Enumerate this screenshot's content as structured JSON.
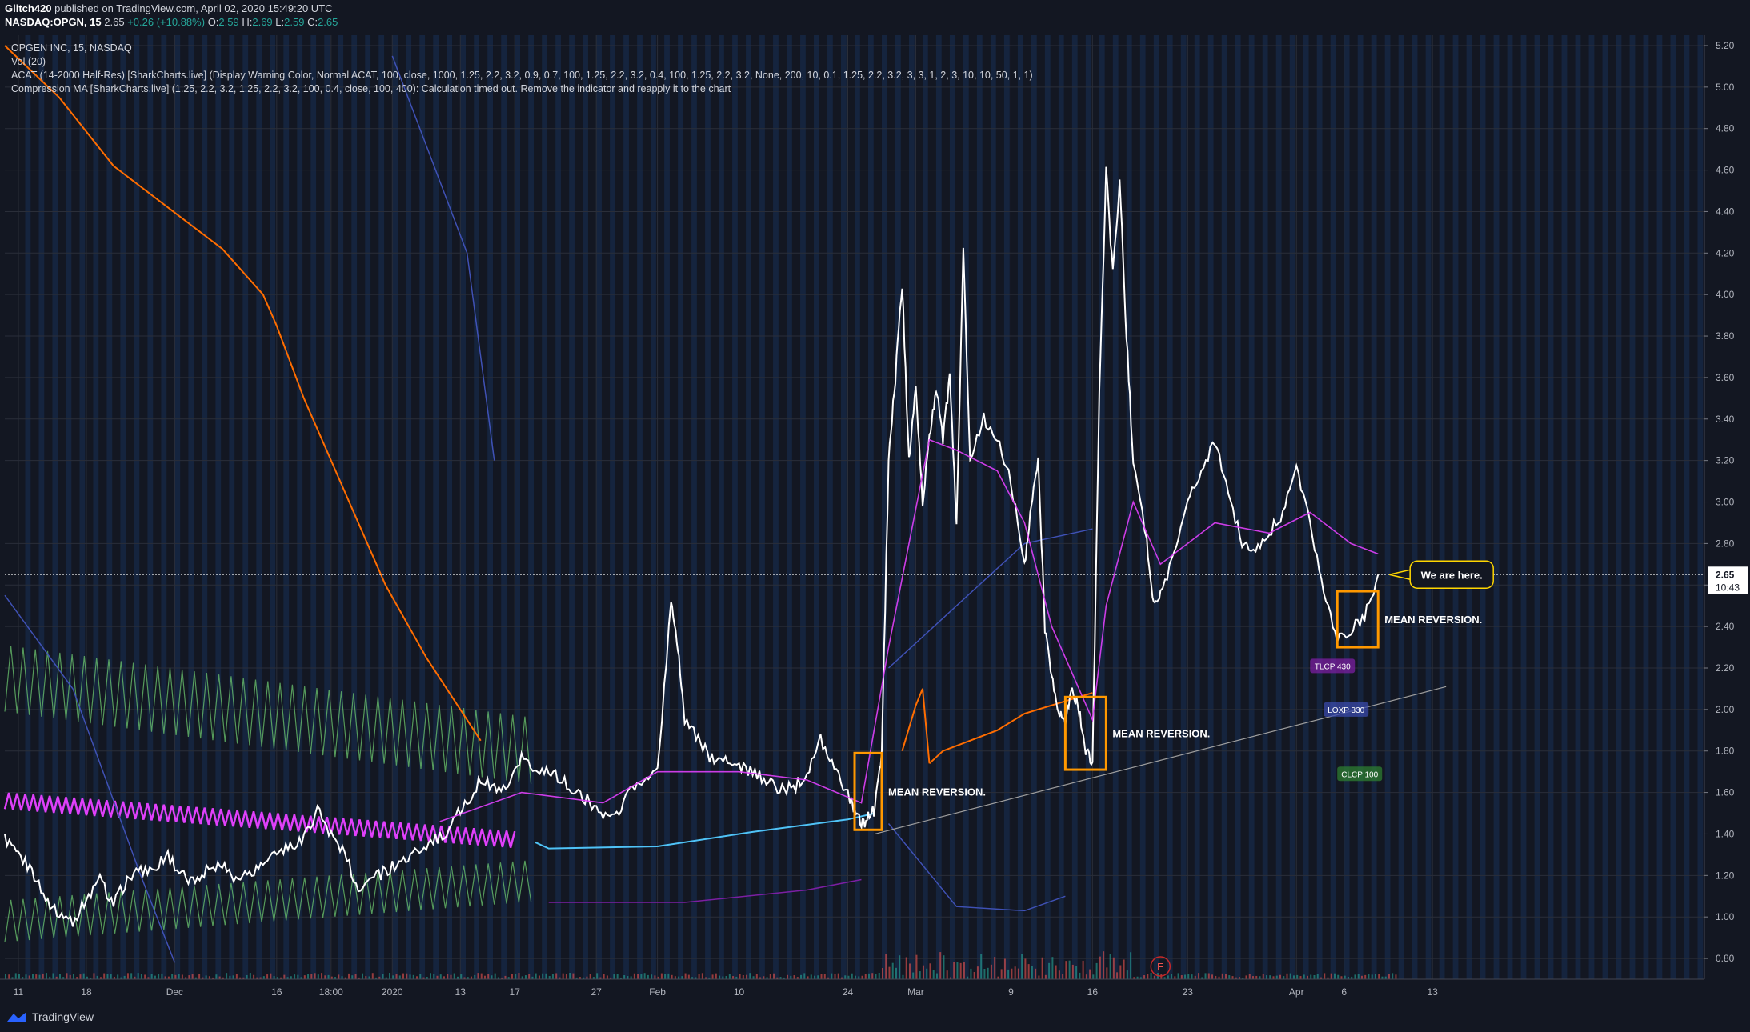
{
  "header": {
    "publisher": "Glitch420",
    "published_text": "published on TradingView.com, April 02, 2020 15:49:20 UTC",
    "symbol": "NASDAQ:OPGN, 15",
    "last": "2.65",
    "change": "+0.26 (+10.88%)",
    "o_label": "O:",
    "o": "2.59",
    "h_label": "H:",
    "h": "2.69",
    "l_label": "L:",
    "l": "2.59",
    "c_label": "C:",
    "c": "2.65"
  },
  "legend": {
    "title": "OPGEN INC, 15, NASDAQ",
    "vol": "Vol (20)",
    "acat": "ACAT (14-2000 Half-Res) [SharkCharts.live] (Display Warning Color, Normal ACAT, 100, close, 1000, 1.25, 2.2, 3.2, 0.9, 0.7, 100, 1.25, 2.2, 3.2, 0.4, 100, 1.25, 2.2, 3.2, None, 200, 10, 0.1, 1.25, 2.2, 3.2, 3, 3, 1, 2, 3, 10, 10, 50, 1, 1)",
    "compression": "Compression MA [SharkCharts.live] (1.25, 2.2, 3.2, 1.25, 2.2, 3.2, 100, 0.4, close, 100, 400): Calculation timed out. Remove the indicator and reapply it to the chart"
  },
  "colors": {
    "background": "#131722",
    "price": "#ffffff",
    "magenta": "#e040fb",
    "orange_ma": "#ff6d00",
    "cyan_ma": "#4fc3f7",
    "green_band": "#66bb6a",
    "blue_band": "#3f51b5",
    "annotation_box": "#ff9800",
    "last_price_tag": "#ffffff"
  },
  "chart_data": {
    "type": "line",
    "symbol": "NASDAQ:OPGN",
    "interval": "15",
    "y_axis_ticks": [
      "5.20",
      "5.00",
      "4.80",
      "4.60",
      "4.40",
      "4.20",
      "4.00",
      "3.80",
      "3.60",
      "3.40",
      "3.20",
      "3.00",
      "2.80",
      "2.60",
      "2.40",
      "2.20",
      "2.00",
      "1.80",
      "1.60",
      "1.40",
      "1.20",
      "1.00",
      "0.80"
    ],
    "ylim": [
      0.7,
      5.25
    ],
    "x_axis_ticks": [
      "11",
      "18",
      "Dec",
      "16",
      "18:00",
      "2020",
      "13",
      "17",
      "27",
      "Feb",
      "10",
      "24",
      "Mar",
      "9",
      "16",
      "23",
      "Apr",
      "6",
      "13"
    ],
    "price_series": [
      {
        "t": 0,
        "v": 1.38
      },
      {
        "t": 2,
        "v": 1.3
      },
      {
        "t": 4,
        "v": 1.22
      },
      {
        "t": 6,
        "v": 1.09
      },
      {
        "t": 8,
        "v": 1.02
      },
      {
        "t": 10,
        "v": 0.98
      },
      {
        "t": 12,
        "v": 1.08
      },
      {
        "t": 14,
        "v": 1.18
      },
      {
        "t": 16,
        "v": 1.06
      },
      {
        "t": 18,
        "v": 1.18
      },
      {
        "t": 20,
        "v": 1.22
      },
      {
        "t": 22,
        "v": 1.24
      },
      {
        "t": 24,
        "v": 1.3
      },
      {
        "t": 26,
        "v": 1.2
      },
      {
        "t": 28,
        "v": 1.16
      },
      {
        "t": 30,
        "v": 1.24
      },
      {
        "t": 32,
        "v": 1.26
      },
      {
        "t": 34,
        "v": 1.18
      },
      {
        "t": 36,
        "v": 1.22
      },
      {
        "t": 38,
        "v": 1.25
      },
      {
        "t": 40,
        "v": 1.3
      },
      {
        "t": 42,
        "v": 1.34
      },
      {
        "t": 44,
        "v": 1.38
      },
      {
        "t": 46,
        "v": 1.52
      },
      {
        "t": 48,
        "v": 1.4
      },
      {
        "t": 50,
        "v": 1.3
      },
      {
        "t": 52,
        "v": 1.14
      },
      {
        "t": 54,
        "v": 1.18
      },
      {
        "t": 56,
        "v": 1.22
      },
      {
        "t": 58,
        "v": 1.26
      },
      {
        "t": 60,
        "v": 1.3
      },
      {
        "t": 62,
        "v": 1.35
      },
      {
        "t": 64,
        "v": 1.38
      },
      {
        "t": 66,
        "v": 1.46
      },
      {
        "t": 68,
        "v": 1.56
      },
      {
        "t": 70,
        "v": 1.66
      },
      {
        "t": 72,
        "v": 1.62
      },
      {
        "t": 74,
        "v": 1.6
      },
      {
        "t": 76,
        "v": 1.78
      },
      {
        "t": 78,
        "v": 1.72
      },
      {
        "t": 80,
        "v": 1.7
      },
      {
        "t": 82,
        "v": 1.66
      },
      {
        "t": 84,
        "v": 1.6
      },
      {
        "t": 86,
        "v": 1.56
      },
      {
        "t": 88,
        "v": 1.48
      },
      {
        "t": 90,
        "v": 1.5
      },
      {
        "t": 92,
        "v": 1.62
      },
      {
        "t": 94,
        "v": 1.64
      },
      {
        "t": 96,
        "v": 1.7
      },
      {
        "t": 98,
        "v": 2.52
      },
      {
        "t": 99,
        "v": 2.3
      },
      {
        "t": 100,
        "v": 1.95
      },
      {
        "t": 102,
        "v": 1.85
      },
      {
        "t": 104,
        "v": 1.76
      },
      {
        "t": 106,
        "v": 1.75
      },
      {
        "t": 108,
        "v": 1.72
      },
      {
        "t": 110,
        "v": 1.7
      },
      {
        "t": 112,
        "v": 1.65
      },
      {
        "t": 114,
        "v": 1.62
      },
      {
        "t": 116,
        "v": 1.62
      },
      {
        "t": 118,
        "v": 1.7
      },
      {
        "t": 120,
        "v": 1.86
      },
      {
        "t": 122,
        "v": 1.72
      },
      {
        "t": 124,
        "v": 1.6
      },
      {
        "t": 125,
        "v": 1.52
      },
      {
        "t": 126,
        "v": 1.44
      },
      {
        "t": 127,
        "v": 1.48
      },
      {
        "t": 128,
        "v": 1.52
      },
      {
        "t": 129,
        "v": 1.8
      },
      {
        "t": 130,
        "v": 3.2
      },
      {
        "t": 131,
        "v": 3.6
      },
      {
        "t": 132,
        "v": 4.05
      },
      {
        "t": 133,
        "v": 3.2
      },
      {
        "t": 134,
        "v": 3.55
      },
      {
        "t": 135,
        "v": 3.0
      },
      {
        "t": 136,
        "v": 3.3
      },
      {
        "t": 137,
        "v": 3.55
      },
      {
        "t": 138,
        "v": 3.3
      },
      {
        "t": 139,
        "v": 3.6
      },
      {
        "t": 140,
        "v": 2.9
      },
      {
        "t": 141,
        "v": 4.2
      },
      {
        "t": 142,
        "v": 3.2
      },
      {
        "t": 144,
        "v": 3.4
      },
      {
        "t": 146,
        "v": 3.3
      },
      {
        "t": 148,
        "v": 3.1
      },
      {
        "t": 150,
        "v": 2.7
      },
      {
        "t": 151,
        "v": 3.0
      },
      {
        "t": 152,
        "v": 3.2
      },
      {
        "t": 153,
        "v": 2.4
      },
      {
        "t": 154,
        "v": 2.15
      },
      {
        "t": 155,
        "v": 2.0
      },
      {
        "t": 156,
        "v": 1.95
      },
      {
        "t": 157,
        "v": 2.1
      },
      {
        "t": 158,
        "v": 2.0
      },
      {
        "t": 159,
        "v": 1.8
      },
      {
        "t": 160,
        "v": 1.75
      },
      {
        "t": 161,
        "v": 3.5
      },
      {
        "t": 162,
        "v": 4.6
      },
      {
        "t": 163,
        "v": 4.1
      },
      {
        "t": 164,
        "v": 4.55
      },
      {
        "t": 165,
        "v": 3.8
      },
      {
        "t": 166,
        "v": 3.2
      },
      {
        "t": 168,
        "v": 2.8
      },
      {
        "t": 169,
        "v": 2.5
      },
      {
        "t": 170,
        "v": 2.55
      },
      {
        "t": 172,
        "v": 2.75
      },
      {
        "t": 174,
        "v": 3.0
      },
      {
        "t": 176,
        "v": 3.15
      },
      {
        "t": 178,
        "v": 3.3
      },
      {
        "t": 180,
        "v": 3.05
      },
      {
        "t": 182,
        "v": 2.8
      },
      {
        "t": 184,
        "v": 2.75
      },
      {
        "t": 186,
        "v": 2.85
      },
      {
        "t": 188,
        "v": 2.95
      },
      {
        "t": 190,
        "v": 3.15
      },
      {
        "t": 192,
        "v": 2.9
      },
      {
        "t": 194,
        "v": 2.55
      },
      {
        "t": 196,
        "v": 2.35
      },
      {
        "t": 198,
        "v": 2.38
      },
      {
        "t": 200,
        "v": 2.45
      },
      {
        "t": 202,
        "v": 2.65
      }
    ],
    "last_price": 2.65,
    "last_price_label": "2.65",
    "countdown_label": "10:43",
    "annotations": [
      {
        "text": "MEAN REVERSION.",
        "box_t": [
          125,
          129
        ],
        "box_v": [
          1.42,
          1.79
        ]
      },
      {
        "text": "MEAN REVERSION.",
        "box_t": [
          156,
          162
        ],
        "box_v": [
          1.71,
          2.06
        ]
      },
      {
        "text": "MEAN REVERSION.",
        "box_t": [
          196,
          202
        ],
        "box_v": [
          2.3,
          2.57
        ]
      }
    ],
    "callout": "We are here.",
    "tags": [
      {
        "text": "TLCP 430",
        "t": 192,
        "v": 2.21,
        "color": "#7b1fa2"
      },
      {
        "text": "LOXP 330",
        "t": 194,
        "v": 2.0,
        "color": "#3949ab"
      },
      {
        "text": "CLCP 100",
        "t": 196,
        "v": 1.69,
        "color": "#2e7d32"
      }
    ],
    "earnings_marker": "E",
    "grid": true
  }
}
